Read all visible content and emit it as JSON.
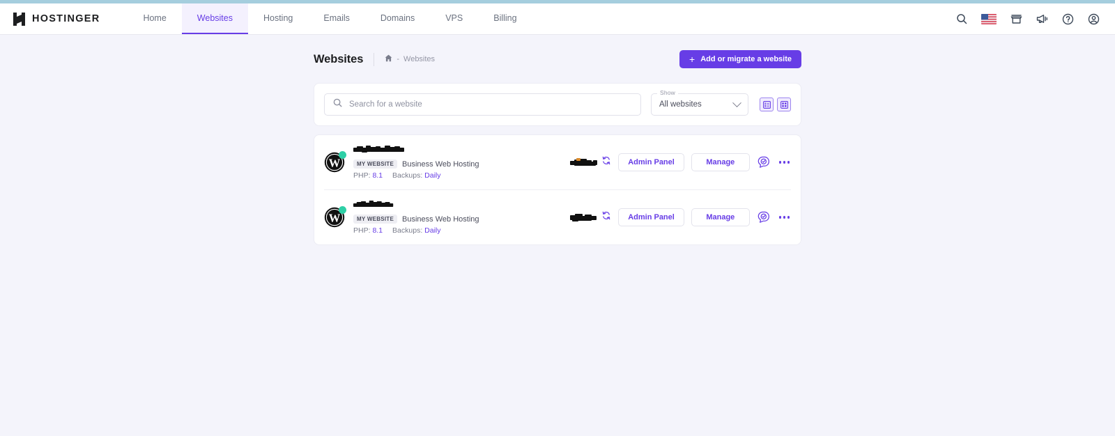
{
  "theme": {
    "accent": "#673de6",
    "accent_light": "#9d85ef",
    "top_strip": "#a5cede",
    "page_bg": "#f4f4fb",
    "status_dot": "#2ecfa6",
    "muted_text": "#7a7d8c"
  },
  "navbar": {
    "brand": "HOSTINGER",
    "items": [
      {
        "label": "Home",
        "active": false
      },
      {
        "label": "Websites",
        "active": true
      },
      {
        "label": "Hosting",
        "active": false
      },
      {
        "label": "Emails",
        "active": false
      },
      {
        "label": "Domains",
        "active": false
      },
      {
        "label": "VPS",
        "active": false
      },
      {
        "label": "Billing",
        "active": false
      }
    ],
    "icons": [
      {
        "name": "search-icon"
      },
      {
        "name": "flag-us-icon"
      },
      {
        "name": "store-icon"
      },
      {
        "name": "megaphone-icon"
      },
      {
        "name": "help-circle-icon"
      },
      {
        "name": "account-circle-icon"
      }
    ]
  },
  "header": {
    "title": "Websites",
    "breadcrumb": {
      "home_icon": "home-icon",
      "separator": "-",
      "current": "Websites"
    },
    "add_button": {
      "label": "Add or migrate a website",
      "icon": "plus-icon"
    }
  },
  "filters": {
    "search": {
      "placeholder": "Search for a website",
      "value": "",
      "icon": "search-icon"
    },
    "show_select": {
      "label": "Show",
      "value": "All websites",
      "options": [
        "All websites"
      ],
      "icon": "chevron-down-icon"
    },
    "view_toggles": [
      {
        "name": "list-view-toggle",
        "icon": "list-view-icon",
        "active": true
      },
      {
        "name": "grid-view-toggle",
        "icon": "grid-view-icon",
        "active": false
      }
    ]
  },
  "websites": [
    {
      "platform_icon": "wordpress-icon",
      "status": "active",
      "name": "",
      "name_redacted": true,
      "tag": "MY WEBSITE",
      "plan": "Business Web Hosting",
      "php_label": "PHP:",
      "php_value": "8.1",
      "backups_label": "Backups:",
      "backups_value": "Daily",
      "domain": "",
      "domain_redacted": true,
      "sync_icon": "refresh-icon",
      "admin_button": "Admin Panel",
      "manage_button": "Manage",
      "chat_icon": "chat-check-icon",
      "more_icon": "more-options-icon"
    },
    {
      "platform_icon": "wordpress-icon",
      "status": "active",
      "name": "",
      "name_redacted": true,
      "tag": "MY WEBSITE",
      "plan": "Business Web Hosting",
      "php_label": "PHP:",
      "php_value": "8.1",
      "backups_label": "Backups:",
      "backups_value": "Daily",
      "domain": "",
      "domain_redacted": true,
      "sync_icon": "refresh-icon",
      "admin_button": "Admin Panel",
      "manage_button": "Manage",
      "chat_icon": "chat-check-icon",
      "more_icon": "more-options-icon"
    }
  ]
}
